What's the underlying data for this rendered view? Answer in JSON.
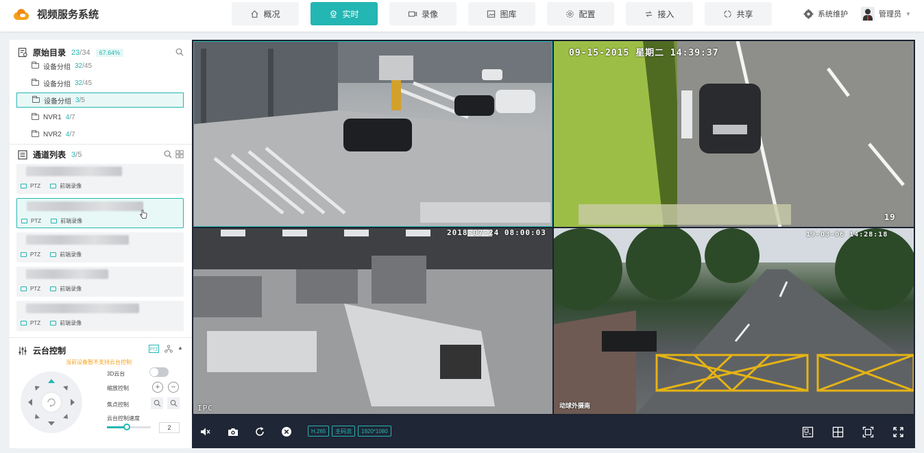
{
  "app": {
    "title": "视频服务系统"
  },
  "nav": [
    {
      "label": "概况",
      "icon": "home-icon"
    },
    {
      "label": "实时",
      "icon": "location-pin-icon",
      "active": true
    },
    {
      "label": "录像",
      "icon": "video-camera-icon"
    },
    {
      "label": "图库",
      "icon": "image-icon"
    },
    {
      "label": "配置",
      "icon": "gear-icon"
    },
    {
      "label": "接入",
      "icon": "connect-icon"
    },
    {
      "label": "共享",
      "icon": "share-icon"
    }
  ],
  "header": {
    "system_label": "系统维护",
    "user_label": "管理员"
  },
  "directory": {
    "title": "原始目录",
    "count": "23",
    "total": "/34",
    "percent": "67.64%",
    "items": [
      {
        "label": "设备分组",
        "count": "32",
        "total": "/45"
      },
      {
        "label": "设备分组",
        "count": "32",
        "total": "/45"
      },
      {
        "label": "设备分组",
        "count": "3",
        "total": "/5",
        "selected": true
      },
      {
        "label": "NVR1",
        "count": "4",
        "total": "/7"
      },
      {
        "label": "NVR2",
        "count": "4",
        "total": "/7"
      }
    ]
  },
  "channels": {
    "title": "通道列表",
    "count": "3",
    "total": "/5",
    "items": [
      {
        "ptz": "PTZ",
        "record": "前端录像"
      },
      {
        "ptz": "PTZ",
        "record": "前端录像",
        "selected": true
      },
      {
        "ptz": "PTZ",
        "record": "前端录像"
      },
      {
        "ptz": "PTZ",
        "record": "前端录像"
      },
      {
        "ptz": "PTZ",
        "record": "前端录像"
      }
    ]
  },
  "ptz": {
    "title": "云台控制",
    "warning": "当前设备暂不支持云台控制",
    "label_3d": "3D云台",
    "label_zoom": "缩放控制",
    "label_focus": "焦点控制",
    "label_speed": "云台控制速度",
    "speed_value": "2",
    "speed_fraction": 0.45
  },
  "video": {
    "osd": {
      "cam2_time": "09-15-2015 星期二 14:39:37",
      "cam2_channel": "19",
      "cam3_time": "2018-07-24 08:00:03",
      "cam3_label": "IPC",
      "cam4_time": "19-03-06 14:28:18",
      "cam4_label": "动球外摄南"
    },
    "toolbar": {
      "codec": "H.265",
      "stream": "主码流",
      "resolution": "1920*1080"
    }
  },
  "colors": {
    "accent": "#23b6b3",
    "toolbar_bg": "#1f2636",
    "warning": "#f5a11a"
  }
}
